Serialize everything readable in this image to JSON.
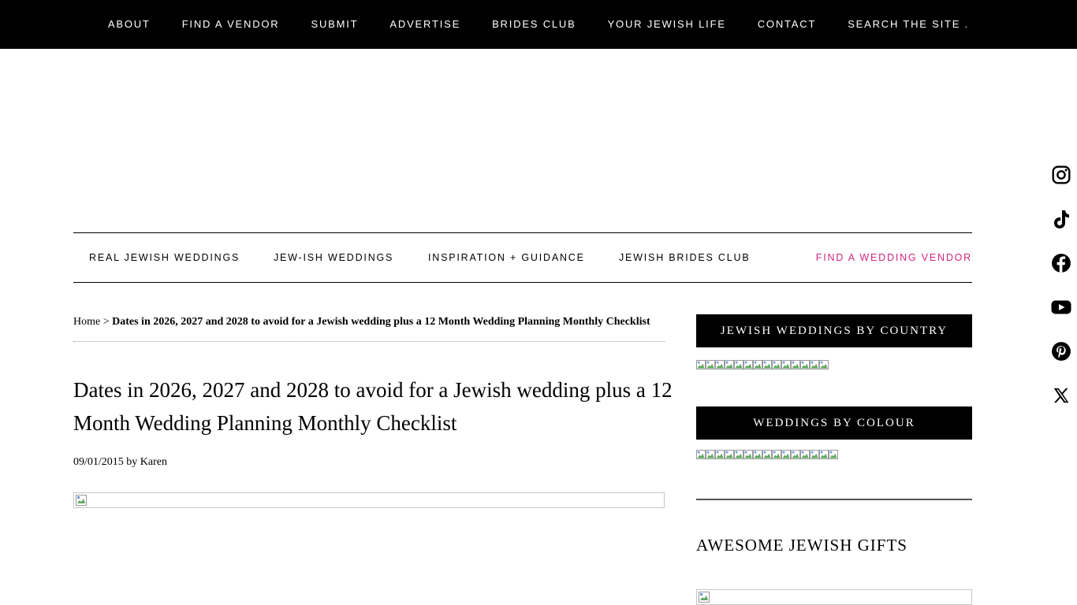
{
  "top_nav": [
    "ABOUT",
    "FIND A VENDOR",
    "SUBMIT",
    "ADVERTISE",
    "BRIDES CLUB",
    "YOUR JEWISH LIFE",
    "CONTACT",
    "SEARCH THE SITE ."
  ],
  "sec_nav": {
    "items": [
      "REAL JEWISH WEDDINGS",
      "JEW-ISH WEDDINGS",
      "INSPIRATION + GUIDANCE",
      "JEWISH BRIDES CLUB"
    ],
    "vendor": "FIND A WEDDING VENDOR",
    "vendor_color": "#d1267f"
  },
  "breadcrumb": {
    "home": "Home",
    "sep": " > ",
    "current": "Dates in 2026, 2027 and 2028 to avoid for a Jewish wedding plus a 12 Month Wedding Planning Monthly Checklist"
  },
  "post": {
    "title": "Dates in 2026, 2027 and 2028 to avoid for a Jewish wedding plus a 12 Month Wedding Planning Monthly Checklist",
    "date": "09/01/2015",
    "by": "by",
    "author": "Karen"
  },
  "sidebar": {
    "country_heading": "JEWISH WEDDINGS BY COUNTRY",
    "colour_heading": "WEDDINGS BY COLOUR",
    "gifts_title": "AWESOME JEWISH GIFTS"
  },
  "social_icons": [
    "instagram-icon",
    "tiktok-icon",
    "facebook-icon",
    "youtube-icon",
    "pinterest-icon",
    "x-icon"
  ]
}
